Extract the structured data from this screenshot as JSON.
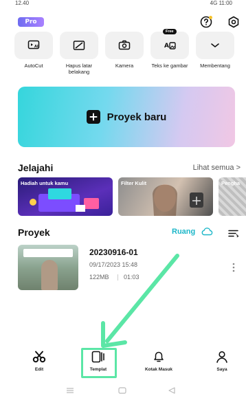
{
  "status_bar": {
    "time": "12.40",
    "right": "4G 11:00"
  },
  "header": {
    "pro_label": "Pro"
  },
  "tools": [
    {
      "label": "AutoCut",
      "icon": "autocut-icon"
    },
    {
      "label": "Hapus latar belakang",
      "icon": "remove-background-icon"
    },
    {
      "label": "Kamera",
      "icon": "camera-icon"
    },
    {
      "label": "Teks ke gambar",
      "icon": "text-to-image-icon",
      "tag": "Free"
    },
    {
      "label": "Membentang",
      "icon": "chevron-down-icon"
    }
  ],
  "new_project": {
    "label": "Proyek baru"
  },
  "explore": {
    "title": "Jelajahi",
    "see_all": "Lihat semua >",
    "cards": [
      {
        "title": "Hadiah untuk kamu"
      },
      {
        "title": "Filter Kulit"
      },
      {
        "title": "Pengha"
      }
    ]
  },
  "projects": {
    "title": "Proyek",
    "space_label": "Ruang",
    "items": [
      {
        "name": "20230916-01",
        "date": "09/17/2023 15:48",
        "size": "122MB",
        "duration": "01:03"
      }
    ]
  },
  "bottom_nav": [
    {
      "label": "Edit",
      "icon": "scissors-icon"
    },
    {
      "label": "Templat",
      "icon": "template-icon"
    },
    {
      "label": "Kotak Masuk",
      "icon": "bell-icon"
    },
    {
      "label": "Saya",
      "icon": "person-icon"
    }
  ],
  "colors": {
    "accent": "#1bb6c8",
    "highlight": "#5be6a6",
    "pro_badge": "#7b6cf2"
  }
}
